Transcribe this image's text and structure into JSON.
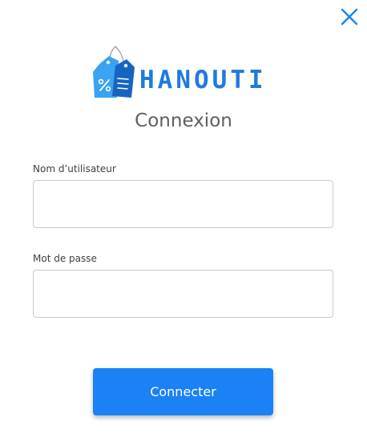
{
  "app": {
    "brand_name": "HANOUTI"
  },
  "dialog": {
    "title": "Connexion",
    "close_icon": "close-icon"
  },
  "form": {
    "username": {
      "label": "Nom d’utilisateur",
      "value": "",
      "placeholder": ""
    },
    "password": {
      "label": "Mot de passe",
      "value": "",
      "placeholder": ""
    },
    "submit_label": "Connecter"
  },
  "colors": {
    "accent": "#1a82f5",
    "brand": "#1f7ae0",
    "title_text": "#5f5f5f",
    "input_border": "#c9c9c9"
  }
}
